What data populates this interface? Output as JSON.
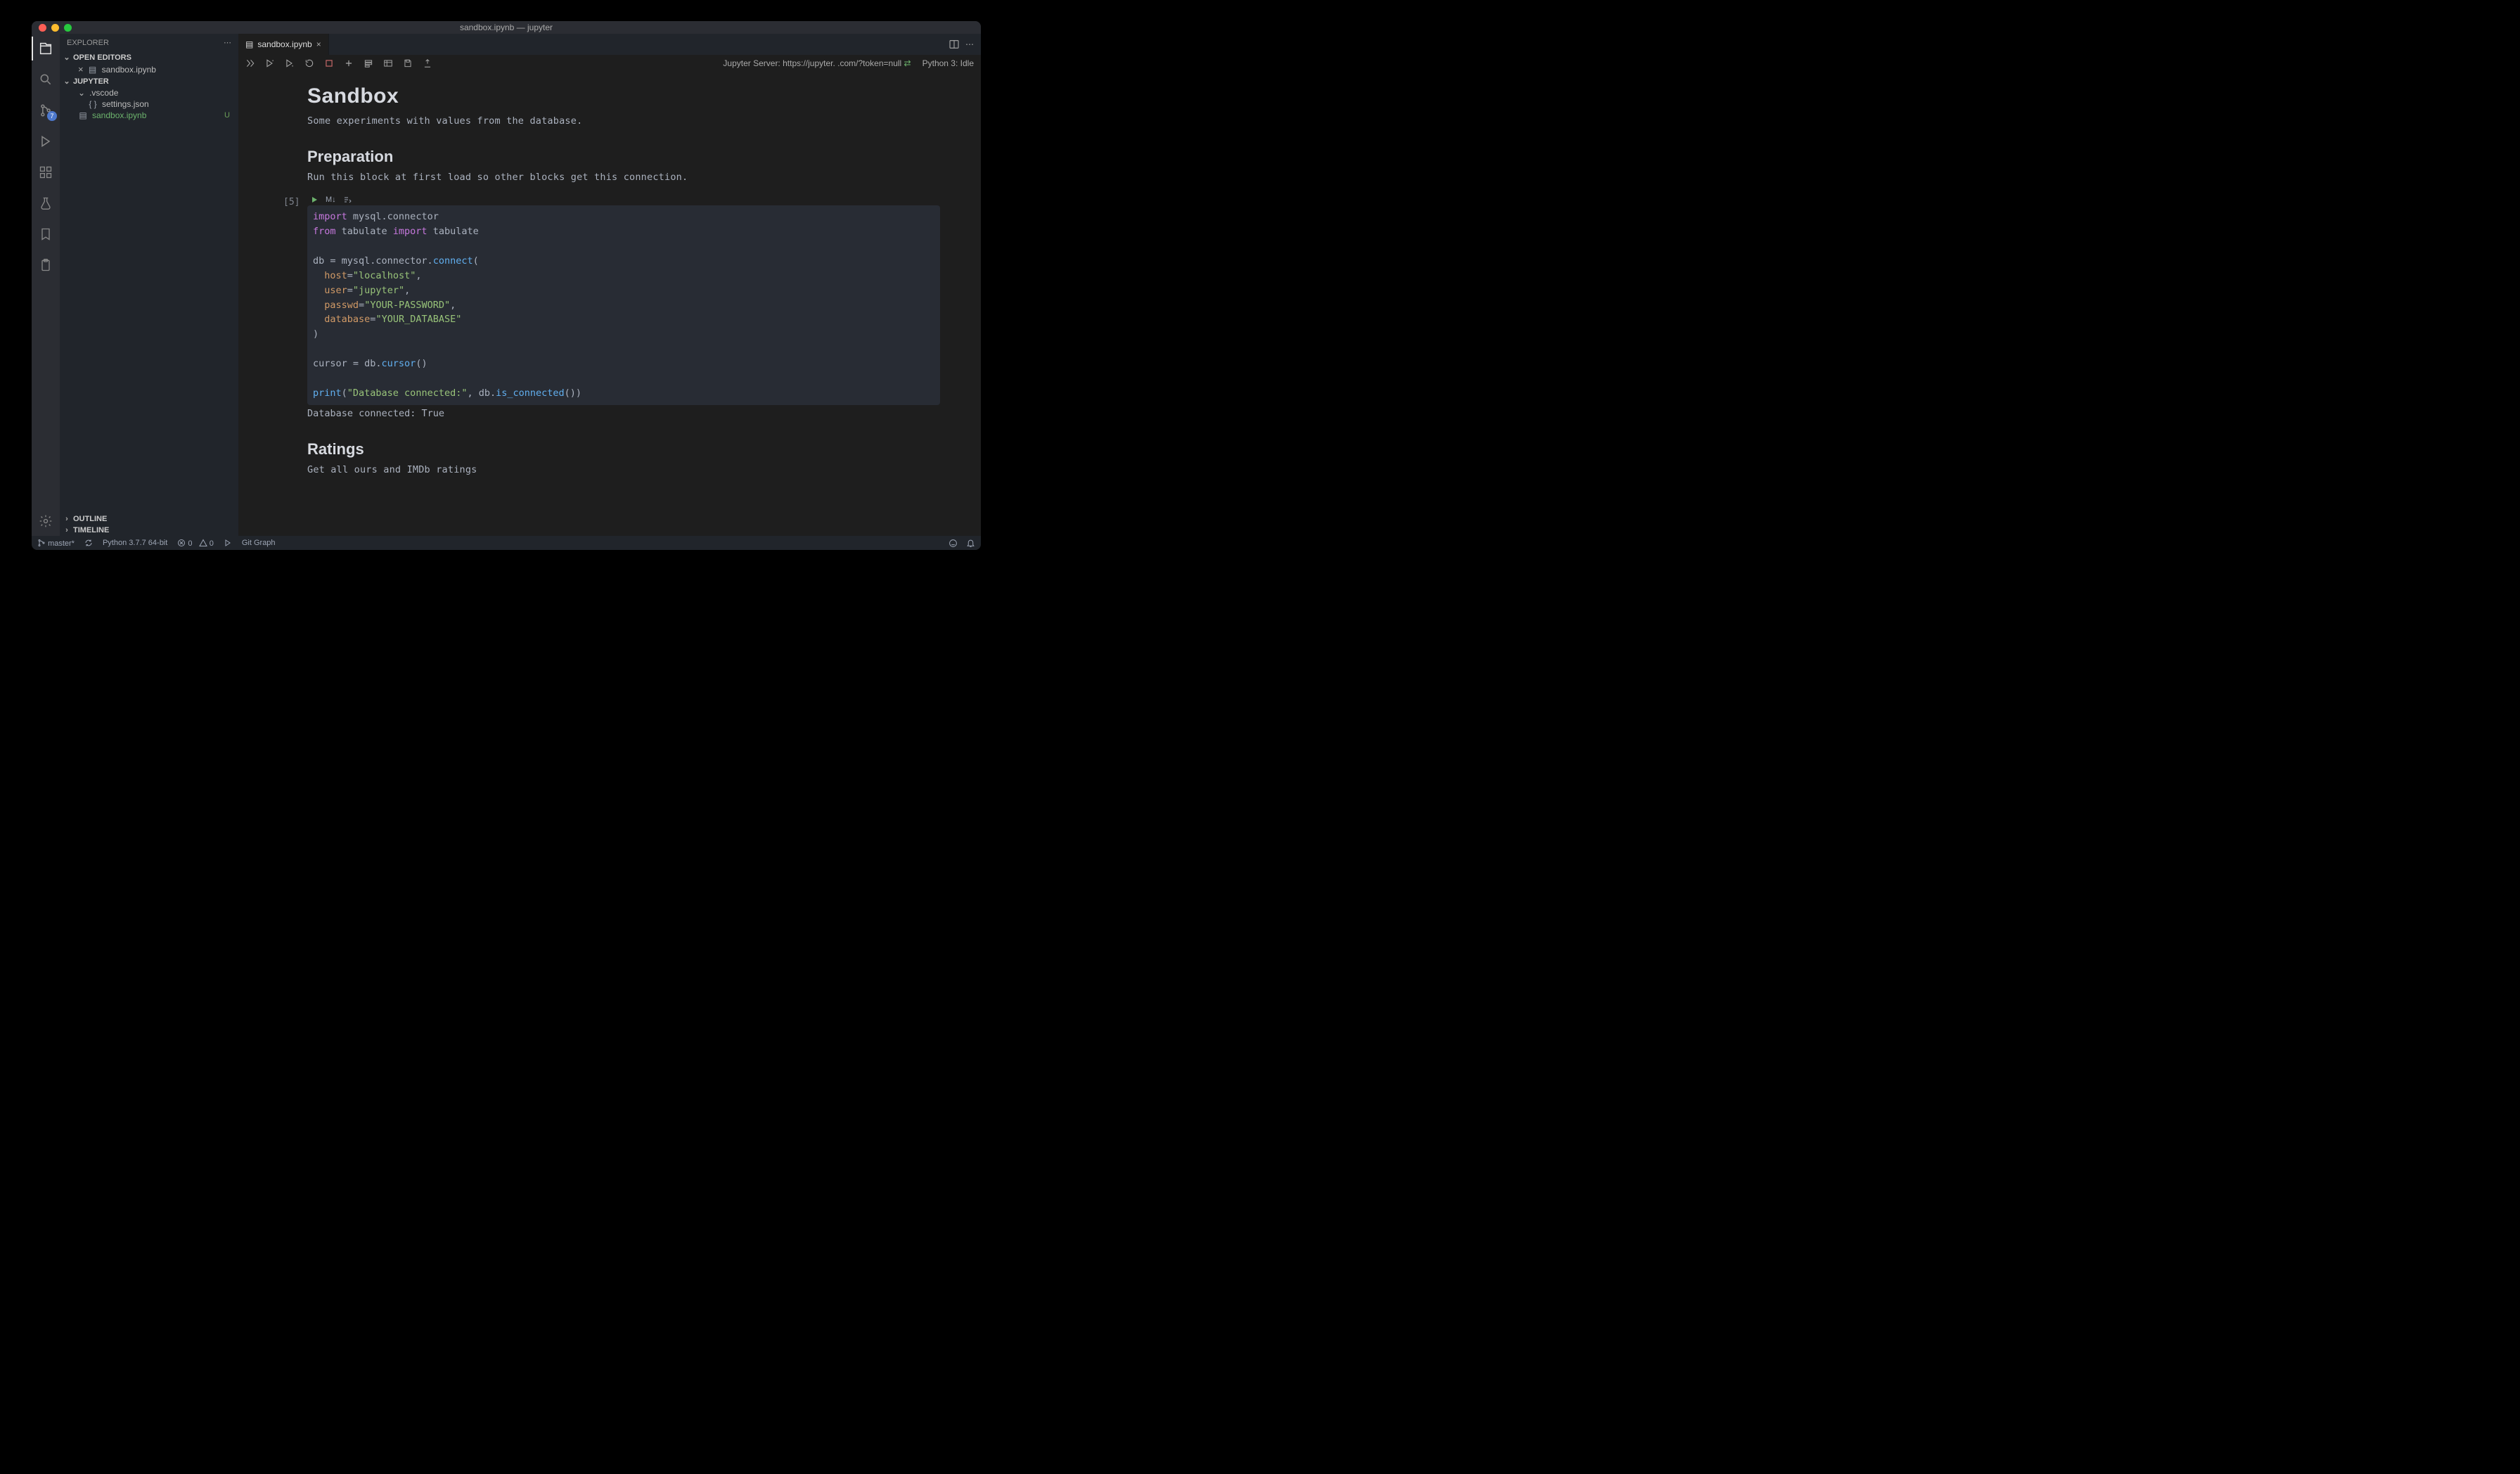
{
  "window": {
    "title": "sandbox.ipynb — jupyter"
  },
  "activitybar": {
    "sourceControlBadge": "7"
  },
  "sidebar": {
    "title": "EXPLORER",
    "sections": {
      "openEditors": {
        "label": "OPEN EDITORS",
        "items": [
          {
            "label": "sandbox.ipynb"
          }
        ]
      },
      "workspace": {
        "label": "JUPYTER",
        "tree": {
          "vscodeFolder": ".vscode",
          "settingsJson": "settings.json",
          "sandbox": "sandbox.ipynb",
          "sandboxDecor": "U"
        }
      },
      "outline": {
        "label": "OUTLINE"
      },
      "timeline": {
        "label": "TIMELINE"
      }
    }
  },
  "tabs": {
    "open": [
      {
        "label": "sandbox.ipynb"
      }
    ]
  },
  "notebookToolbar": {
    "right": {
      "server": "Jupyter Server: https://jupyter.                     .com/?token=null",
      "kernel": "Python 3: Idle"
    }
  },
  "notebook": {
    "md1": {
      "h1": "Sandbox",
      "p": "Some experiments with values from the database."
    },
    "md2": {
      "h2": "Preparation",
      "p": "Run this block at first load so other blocks get this connection."
    },
    "cell1": {
      "execCount": "[5]",
      "output": "Database connected: True"
    },
    "md3": {
      "h2": "Ratings",
      "p": "Get all ours and IMDb ratings"
    }
  },
  "statusbar": {
    "branch": "master*",
    "python": "Python 3.7.7 64-bit",
    "errors": "0",
    "warnings": "0",
    "gitgraph": "Git Graph"
  }
}
